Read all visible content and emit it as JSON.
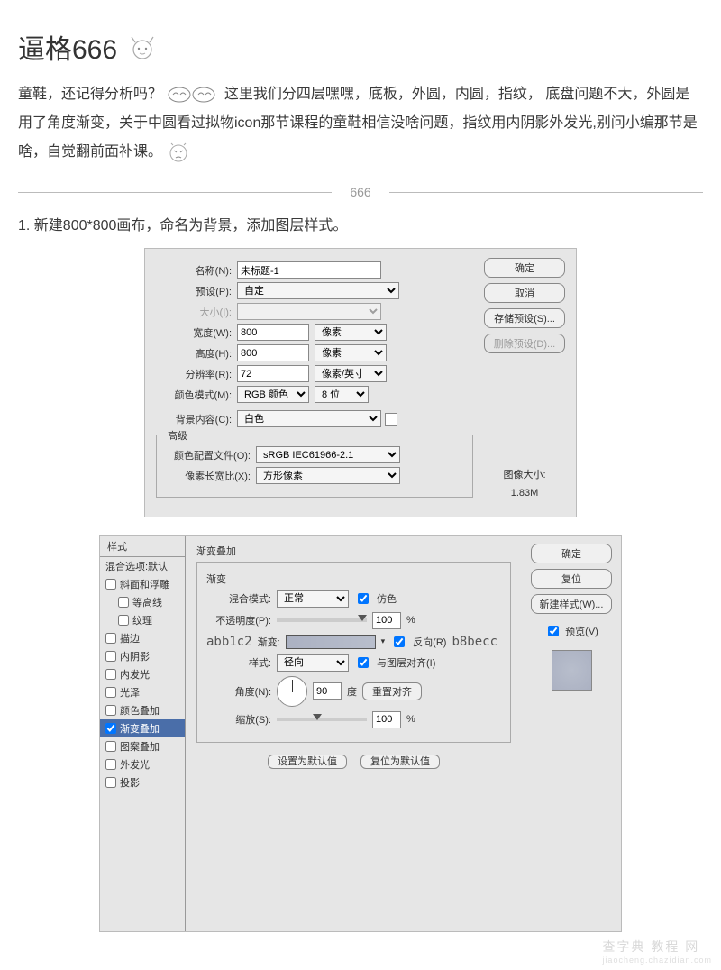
{
  "heading": "逼格666",
  "intro": {
    "p1a": "童鞋，还记得分析吗？",
    "p1b": "这里我们分四层嘿嘿，底板，外圆，内圆，指纹，",
    "p2": "底盘问题不大，外圆是用了角度渐变，关于中圆看过拟物icon那节课程的童鞋相信没啥问题，指纹用内阴影外发光,别问小编那节是啥，自觉翻前面补课。"
  },
  "divider": "666",
  "step1": "1. 新建800*800画布，命名为背景，添加图层样式。",
  "newdoc": {
    "name_lbl": "名称(N):",
    "name_val": "未标题-1",
    "preset_lbl": "预设(P):",
    "preset_val": "自定",
    "size_lbl": "大小(I):",
    "width_lbl": "宽度(W):",
    "width_val": "800",
    "width_unit": "像素",
    "height_lbl": "高度(H):",
    "height_val": "800",
    "height_unit": "像素",
    "res_lbl": "分辨率(R):",
    "res_val": "72",
    "res_unit": "像素/英寸",
    "mode_lbl": "颜色模式(M):",
    "mode_val": "RGB 颜色",
    "depth_val": "8 位",
    "bg_lbl": "背景内容(C):",
    "bg_val": "白色",
    "adv": "高级",
    "profile_lbl": "颜色配置文件(O):",
    "profile_val": "sRGB IEC61966-2.1",
    "aspect_lbl": "像素长宽比(X):",
    "aspect_val": "方形像素",
    "ok": "确定",
    "cancel": "取消",
    "save_preset": "存储预设(S)...",
    "del_preset": "删除预设(D)...",
    "imgsize_lbl": "图像大小:",
    "imgsize_val": "1.83M"
  },
  "layerstyle": {
    "styles_header": "样式",
    "blend_default": "混合选项:默认",
    "items": [
      {
        "label": "斜面和浮雕",
        "checked": false
      },
      {
        "label": "等高线",
        "checked": false,
        "indent": true
      },
      {
        "label": "纹理",
        "checked": false,
        "indent": true
      },
      {
        "label": "描边",
        "checked": false
      },
      {
        "label": "内阴影",
        "checked": false
      },
      {
        "label": "内发光",
        "checked": false
      },
      {
        "label": "光泽",
        "checked": false
      },
      {
        "label": "颜色叠加",
        "checked": false
      },
      {
        "label": "渐变叠加",
        "checked": true,
        "selected": true
      },
      {
        "label": "图案叠加",
        "checked": false
      },
      {
        "label": "外发光",
        "checked": false
      },
      {
        "label": "投影",
        "checked": false
      }
    ],
    "section_title": "渐变叠加",
    "sub_title": "渐变",
    "blend_lbl": "混合模式:",
    "blend_val": "正常",
    "dither_lbl": "仿色",
    "opacity_lbl": "不透明度(P):",
    "opacity_val": "100",
    "pct": "%",
    "color_left": "abb1c2",
    "grad_lbl": "渐变:",
    "reverse_lbl": "反向(R)",
    "color_right": "b8becc",
    "style_lbl": "样式:",
    "style_val": "径向",
    "align_lbl": "与图层对齐(I)",
    "angle_lbl": "角度(N):",
    "angle_val": "90",
    "deg": "度",
    "reset_align": "重置对齐",
    "scale_lbl": "缩放(S):",
    "scale_val": "100",
    "set_default": "设置为默认值",
    "reset_default": "复位为默认值",
    "ok": "确定",
    "reset": "复位",
    "new_style": "新建样式(W)...",
    "preview_lbl": "预览(V)"
  },
  "watermark": {
    "main": "查字典 教程 网",
    "sub": "jiaocheng.chazidian.com"
  }
}
